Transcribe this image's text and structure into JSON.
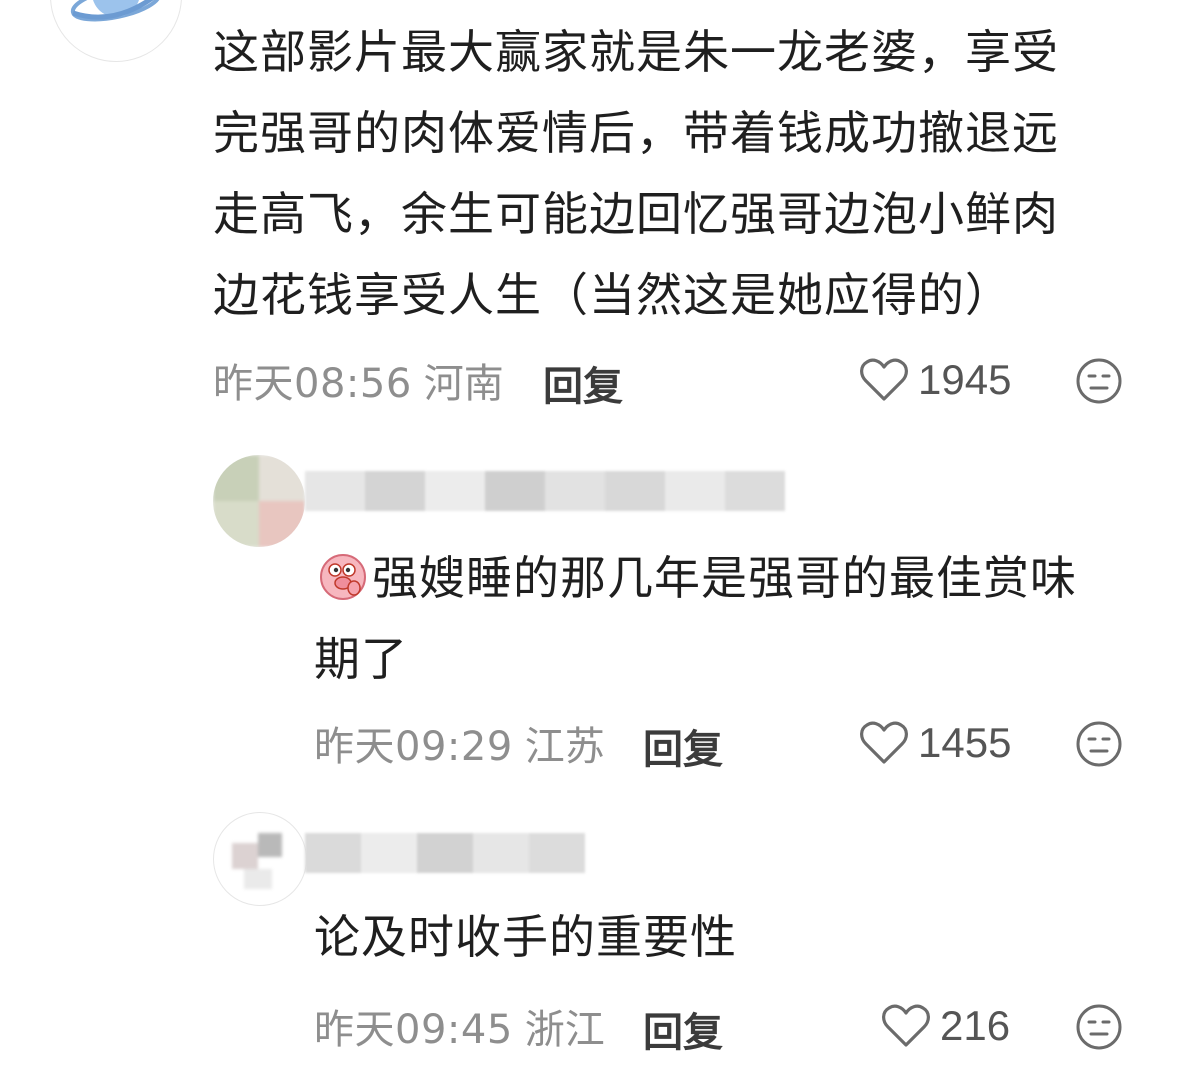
{
  "comments": [
    {
      "text": "这部影片最大赢家就是朱一龙老婆，享受\n完强哥的肉体爱情后，带着钱成功撤退远\n走高飞，余生可能边回忆强哥边泡小鲜肉\n边花钱享受人生（当然这是她应得的）",
      "time": "昨天08:56",
      "region": "河南",
      "reply_label": "回复",
      "likes": "1945"
    },
    {
      "text": "强嫂睡的那几年是强哥的最佳赏味\n期了",
      "time": "昨天09:29",
      "region": "江苏",
      "reply_label": "回复",
      "likes": "1455"
    },
    {
      "text": "论及时收手的重要性",
      "time": "昨天09:45",
      "region": "浙江",
      "reply_label": "回复",
      "likes": "216"
    }
  ],
  "colors": {
    "text": "#1f1f1f",
    "meta": "#8e8e8e",
    "reply": "#3b3b3b",
    "icon": "#6b6b6b"
  },
  "icons": {
    "like": "heart-outline-icon",
    "dislike": "neutral-face-icon",
    "emoji": "pig-emoji-icon",
    "avatar1": "planet-icon"
  }
}
